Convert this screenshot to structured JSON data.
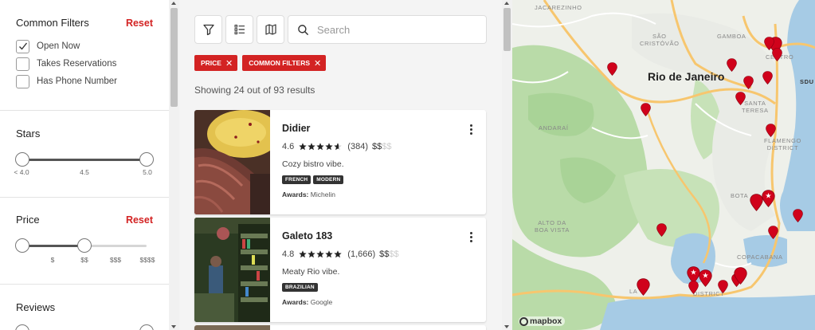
{
  "filters": {
    "common": {
      "title": "Common Filters",
      "reset": "Reset",
      "options": [
        {
          "label": "Open Now",
          "checked": true
        },
        {
          "label": "Takes Reservations",
          "checked": false
        },
        {
          "label": "Has Phone Number",
          "checked": false
        }
      ]
    },
    "stars": {
      "title": "Stars",
      "ticks": [
        "< 4.0",
        "4.5",
        "5.0"
      ]
    },
    "price": {
      "title": "Price",
      "reset": "Reset",
      "ticks": [
        "$",
        "$$",
        "$$$",
        "$$$$"
      ]
    },
    "reviews": {
      "title": "Reviews"
    }
  },
  "toolbar": {
    "filter_icon": "filter-icon",
    "list_icon": "list-icon",
    "map_icon": "map-icon",
    "search_placeholder": "Search"
  },
  "active_chips": [
    {
      "label": "PRICE"
    },
    {
      "label": "COMMON FILTERS"
    }
  ],
  "results_summary": "Showing 24 out of 93 results",
  "restaurants": [
    {
      "name": "Didier",
      "rating": "4.6",
      "stars": 4.6,
      "reviews": "(384)",
      "price_on": "$$",
      "price_off": "$$",
      "description": "Cozy bistro vibe.",
      "tags": [
        "FRENCH",
        "MODERN"
      ],
      "awards_label": "Awards:",
      "awards": "Michelin"
    },
    {
      "name": "Galeto 183",
      "rating": "4.8",
      "stars": 4.8,
      "reviews": "(1,666)",
      "price_on": "$$",
      "price_off": "$$",
      "description": "Meaty Rio vibe.",
      "tags": [
        "BRAZILIAN"
      ],
      "awards_label": "Awards:",
      "awards": "Google"
    }
  ],
  "map": {
    "city": "Rio de Janeiro",
    "attribution": "mapbox",
    "neighborhoods": [
      {
        "name": "JACAREZINHO"
      },
      {
        "name": "SÃO\nCRISTÓVÃO"
      },
      {
        "name": "GAMBOA"
      },
      {
        "name": "CENTRO"
      },
      {
        "name": "SANTA\nTERESA"
      },
      {
        "name": "FLAMENGO\nDISTRICT"
      },
      {
        "name": "ANDARAÍ"
      },
      {
        "name": "ALTO DA\nBOA VISTA"
      },
      {
        "name": "BOTA"
      },
      {
        "name": "COPACABANA"
      },
      {
        "name": "DISTRICT"
      },
      {
        "name": "LA"
      },
      {
        "name": "SDU"
      }
    ],
    "pin_color": "#d0021b",
    "water_color": "#a6cbe5",
    "park_color": "#b9dba8"
  }
}
